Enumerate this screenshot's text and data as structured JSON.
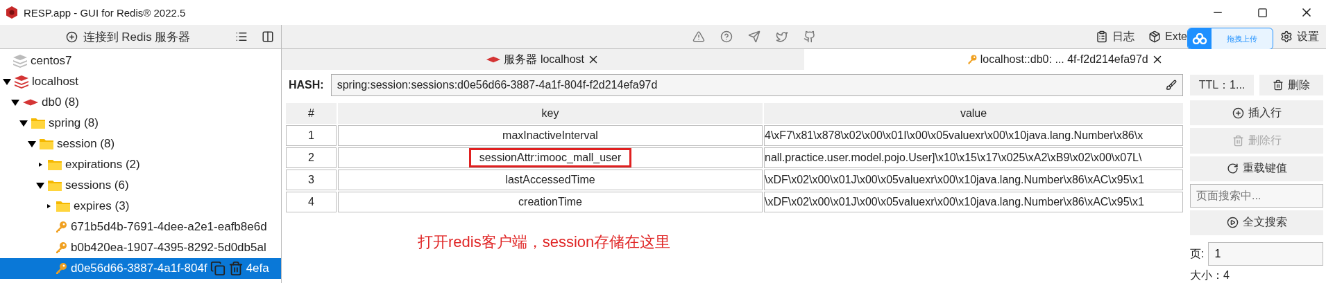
{
  "window": {
    "title": "RESP.app - GUI for Redis® 2022.5"
  },
  "sidebar": {
    "connect_button": "连接到 Redis 服务器",
    "tree": [
      {
        "kind": "server",
        "label": "centos7",
        "connected": false,
        "selected": false
      },
      {
        "kind": "server",
        "label": "localhost",
        "connected": true,
        "expanded": true,
        "selected": false,
        "children": [
          {
            "kind": "db",
            "label": "db0  (8)",
            "expanded": true,
            "selected": false,
            "children": [
              {
                "kind": "folder",
                "label": "spring (8)",
                "expanded": true,
                "selected": false,
                "children": [
                  {
                    "kind": "folder",
                    "label": "session (8)",
                    "expanded": true,
                    "selected": false,
                    "children": [
                      {
                        "kind": "folder",
                        "label": "expirations (2)",
                        "expanded": false,
                        "selected": false
                      },
                      {
                        "kind": "folder",
                        "label": "sessions (6)",
                        "expanded": true,
                        "selected": false,
                        "children": [
                          {
                            "kind": "folder",
                            "label": "expires (3)",
                            "expanded": false,
                            "selected": false
                          },
                          {
                            "kind": "key",
                            "label": "671b5d4b-7691-4dee-a2e1-eafb8e6d",
                            "selected": false
                          },
                          {
                            "kind": "key",
                            "label": "b0b420ea-1907-4395-8292-5d0db5al",
                            "selected": false
                          },
                          {
                            "kind": "key",
                            "label": "d0e56d66-3887-4a1f-804f",
                            "label_tail": "4efa",
                            "selected": true
                          }
                        ]
                      }
                    ]
                  }
                ]
              }
            ]
          }
        ]
      }
    ]
  },
  "toolbar": {
    "log": "日志",
    "extensions": "Exte",
    "upload_widget": "拖拽上传",
    "settings": "设置"
  },
  "tabs": [
    {
      "kind": "server",
      "label": "服务器 localhost",
      "selected": false
    },
    {
      "kind": "key",
      "label": "localhost::db0: ... 4f-f2d214efa97d",
      "selected": true
    }
  ],
  "key_view": {
    "type_label": "HASH:",
    "key_name": "spring:session:sessions:d0e56d66-3887-4a1f-804f-f2d214efa97d",
    "ttl_button": "TTL：1...",
    "delete_button": "删除",
    "table": {
      "columns": [
        "#",
        "key",
        "value"
      ],
      "rows": [
        {
          "index": "1",
          "key": "maxInactiveInterval",
          "value": "4\\xF7\\x81\\x878\\x02\\x00\\x01I\\x00\\x05valuexr\\x00\\x10java.lang.Number\\x86\\x",
          "highlighted": false
        },
        {
          "index": "2",
          "key": "sessionAttr:imooc_mall_user",
          "value": "nall.practice.user.model.pojo.User]\\x10\\x15\\x17\\x025\\xA2\\xB9\\x02\\x00\\x07L\\",
          "highlighted": true
        },
        {
          "index": "3",
          "key": "lastAccessedTime",
          "value": "\\xDF\\x02\\x00\\x01J\\x00\\x05valuexr\\x00\\x10java.lang.Number\\x86\\xAC\\x95\\x1",
          "highlighted": false
        },
        {
          "index": "4",
          "key": "creationTime",
          "value": "\\xDF\\x02\\x00\\x01J\\x00\\x05valuexr\\x00\\x10java.lang.Number\\x86\\xAC\\x95\\x1",
          "highlighted": false
        }
      ]
    },
    "annotation": "打开redis客户端，session存储在这里",
    "actions": [
      {
        "kind": "insert",
        "label": "插入行",
        "disabled": false
      },
      {
        "kind": "delete",
        "label": "删除行",
        "disabled": true
      },
      {
        "kind": "reload",
        "label": "重载键值",
        "disabled": false
      }
    ],
    "search": {
      "placeholder": "页面搜索中..."
    },
    "full_search_button": "全文搜索",
    "page": {
      "label": "页:",
      "value": "1"
    },
    "size": "大小：4"
  }
}
